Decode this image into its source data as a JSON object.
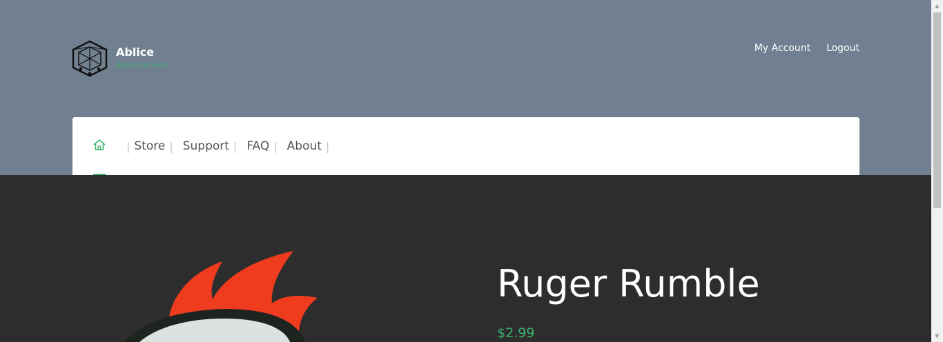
{
  "brand": {
    "name": "Ablice",
    "tagline": "Balice's Services"
  },
  "account_links": [
    {
      "label": "My Account"
    },
    {
      "label": "Logout"
    }
  ],
  "nav": {
    "home_icon": "home-icon",
    "separator": "|",
    "items": [
      {
        "label": "Store"
      },
      {
        "label": "Support"
      },
      {
        "label": "FAQ"
      },
      {
        "label": "About"
      }
    ]
  },
  "product": {
    "title": "Ruger Rumble",
    "price": "$2.99"
  },
  "colors": {
    "header_bg": "#708090",
    "body_bg": "#2d2d2d",
    "accent": "#3cb371",
    "flame": "#f03c1e"
  }
}
